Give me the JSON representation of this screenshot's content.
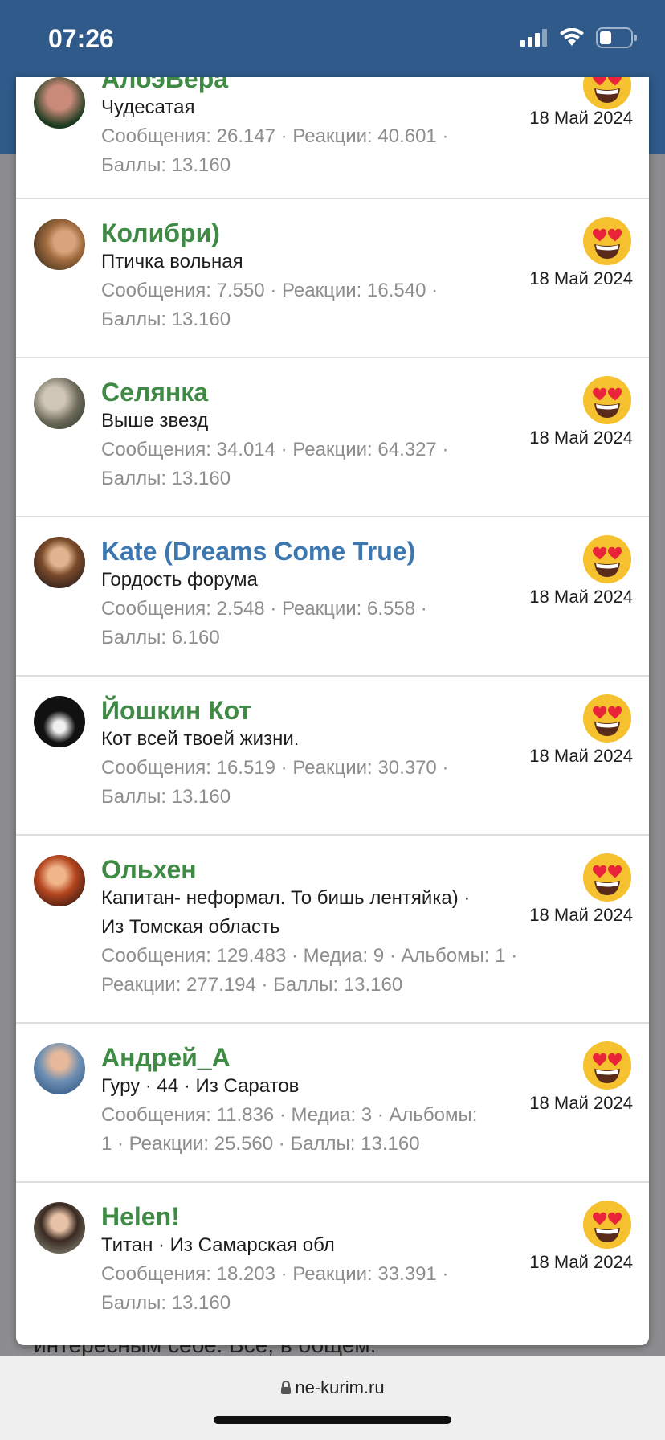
{
  "status": {
    "time": "07:26"
  },
  "background": {
    "text": "интересным себе. Все, в общем:"
  },
  "members": [
    {
      "name": "АлоэВера",
      "title": "Чудесатая",
      "stats_line1": "Сообщения: 26.147 · Реакции: 40.601 ·",
      "stats_line2": "Баллы: 13.160",
      "date": "18 Май 2024",
      "name_color": "green"
    },
    {
      "name": "Колибри)",
      "title": "Птичка вольная",
      "stats_line1": "Сообщения: 7.550 · Реакции: 16.540 ·",
      "stats_line2": "Баллы: 13.160",
      "date": "18 Май 2024",
      "name_color": "green"
    },
    {
      "name": "Селянка",
      "title": "Выше звезд",
      "stats_line1": "Сообщения: 34.014 · Реакции: 64.327 ·",
      "stats_line2": "Баллы: 13.160",
      "date": "18 Май 2024",
      "name_color": "green"
    },
    {
      "name": "Kate (Dreams Come True)",
      "title": "Гордость форума",
      "stats_line1": "Сообщения: 2.548 · Реакции: 6.558 ·",
      "stats_line2": "Баллы: 6.160",
      "date": "18 Май 2024",
      "name_color": "blue"
    },
    {
      "name": "Йошкин Кот",
      "title": "Кот всей твоей жизни.",
      "stats_line1": "Сообщения: 16.519 · Реакции: 30.370 ·",
      "stats_line2": "Баллы: 13.160",
      "date": "18 Май 2024",
      "name_color": "green"
    },
    {
      "name": "Ольхен",
      "title_line1": "Капитан- неформал. То бишь лентяйка) ·",
      "title_line2": "Из Томская область",
      "stats_line1": "Сообщения: 129.483 · Медиа: 9 · Альбомы: 1 ·",
      "stats_line2": "Реакции: 277.194 · Баллы: 13.160",
      "date": "18 Май 2024",
      "name_color": "green"
    },
    {
      "name": "Андрей_А",
      "title": "Гуру · 44 · Из Саратов",
      "stats_line1": "Сообщения: 11.836 · Медиа: 3 · Альбомы:",
      "stats_line2": "1 · Реакции: 25.560 · Баллы: 13.160",
      "date": "18 Май 2024",
      "name_color": "green"
    },
    {
      "name": "Helen!",
      "title": "Титан · Из Самарская обл",
      "stats_line1": "Сообщения: 18.203 · Реакции: 33.391 ·",
      "stats_line2": "Баллы: 13.160",
      "date": "18 Май 2024",
      "name_color": "green"
    }
  ],
  "browser": {
    "url": "ne-kurim.ru"
  },
  "colors": {
    "accent_green": "#3f8a45",
    "accent_blue": "#3c77b0",
    "header_blue": "#2f5a8a"
  },
  "icons": [
    "signal-icon",
    "wifi-icon",
    "battery-icon",
    "heart-eyes-emoji-icon",
    "lock-icon"
  ]
}
